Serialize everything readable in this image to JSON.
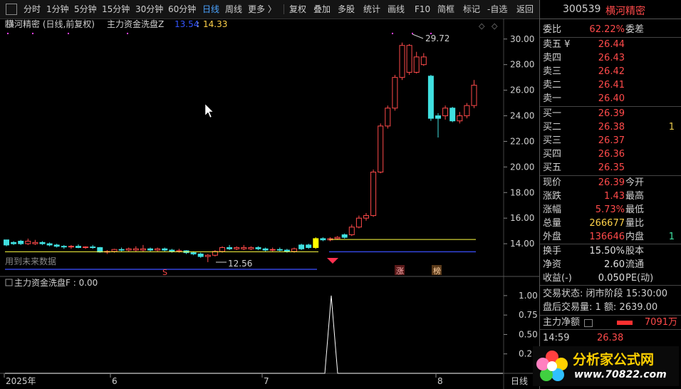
{
  "toolbar": {
    "items": [
      "分时",
      "1分钟",
      "5分钟",
      "15分钟",
      "30分钟",
      "60分钟",
      "日线",
      "周线",
      "更多 〉",
      "复权",
      "叠加",
      "多股",
      "统计",
      "画线",
      "F10",
      "简框",
      "标记",
      "-自选",
      "返回"
    ],
    "active": "日线"
  },
  "main_chart": {
    "title": "横河精密 (日线,前复权)",
    "indicator_name": "主力资金洗盘Z",
    "indicator_val1": "13.54",
    "indicator_val2": "14.33",
    "high_label": "29.72",
    "low_label": "12.56",
    "future_label": "用到未来数据",
    "marker_s": "S",
    "marker_zhang": "涨",
    "marker_bang": "榜"
  },
  "sub_chart": {
    "title": "主力资金洗盘F : 0.00"
  },
  "chart_data": [
    {
      "type": "candlestick",
      "title": "横河精密 (日线,前复权)",
      "y_ticks": [
        14.0,
        16.0,
        18.0,
        20.0,
        22.0,
        24.0,
        26.0,
        28.0,
        30.0
      ],
      "ylim": [
        12.0,
        30.6
      ],
      "x_ticks": [
        "2025年",
        "6",
        "7",
        "8"
      ],
      "high": 29.72,
      "low": 12.56,
      "lines": {
        "yellow": 13.54,
        "blue": 12.56
      }
    },
    {
      "type": "line",
      "title": "主力资金洗盘F : 0.00",
      "y_ticks": [
        0.25,
        0.5,
        0.75,
        1.0
      ],
      "ylim": [
        0,
        1.1
      ],
      "values": [
        0,
        0,
        0,
        0,
        0,
        0,
        0,
        0,
        0,
        0,
        0,
        0,
        0,
        0,
        0,
        0,
        0,
        0,
        0,
        0,
        0,
        0,
        0,
        0,
        0,
        0,
        0,
        0,
        0,
        0,
        0,
        0,
        0,
        0,
        0,
        0,
        0,
        0,
        0,
        0,
        0,
        0,
        0,
        0,
        0,
        0,
        0,
        0,
        0,
        0,
        0,
        0,
        0,
        0,
        0,
        0,
        0,
        1,
        0,
        0,
        0,
        0,
        0,
        0,
        0,
        0,
        0,
        0,
        0,
        0,
        0,
        0,
        0,
        0,
        0,
        0,
        0,
        0,
        0,
        0,
        0,
        0
      ]
    }
  ],
  "quote": {
    "code": "300539",
    "name": "横河精密",
    "weibi_label": "委比",
    "weibi_val": "62.22%",
    "weicha_label": "委差",
    "asks": [
      {
        "label": "卖五 ¥",
        "price": "26.44"
      },
      {
        "label": "卖四",
        "price": "26.43"
      },
      {
        "label": "卖三",
        "price": "26.42"
      },
      {
        "label": "卖二",
        "price": "26.41"
      },
      {
        "label": "卖一",
        "price": "26.40"
      }
    ],
    "bids": [
      {
        "label": "买一",
        "price": "26.39",
        "vol": ""
      },
      {
        "label": "买二",
        "price": "26.38",
        "vol": "1"
      },
      {
        "label": "买三",
        "price": "26.37",
        "vol": ""
      },
      {
        "label": "买四",
        "price": "26.36",
        "vol": ""
      },
      {
        "label": "买五",
        "price": "26.35",
        "vol": ""
      }
    ],
    "stats": [
      {
        "label": "现价",
        "val": "26.39",
        "label2": "今开",
        "cls": "red",
        "side": ""
      },
      {
        "label": "涨跌",
        "val": "1.43",
        "label2": "最高",
        "cls": "red",
        "side": ""
      },
      {
        "label": "涨幅",
        "val": "5.73%",
        "label2": "最低",
        "cls": "red",
        "side": ""
      },
      {
        "label": "总量",
        "val": "266677",
        "label2": "量比",
        "cls": "yellow",
        "side": ""
      },
      {
        "label": "外盘",
        "val": "136646",
        "label2": "内盘",
        "cls": "red",
        "side": "1"
      }
    ],
    "stats2": [
      {
        "label": "换手",
        "val": "15.50%",
        "label2": "股本"
      },
      {
        "label": "净资",
        "val": "2.60",
        "label2": "流通"
      },
      {
        "label": "收益(-)",
        "val": "0.050",
        "label2": "PE(动)"
      }
    ],
    "trade_status": "交易状态: 闭市阶段 15:30:00",
    "after_hours": "盘后交易量: 1  额: 2639.00",
    "net_label": "主力净额",
    "net_val": "7091万",
    "tick_time": "14:59",
    "tick_price": "26.38"
  },
  "watermark": {
    "text": "分析家公式网",
    "url": "www.70822.com"
  },
  "period_tab": "日线"
}
